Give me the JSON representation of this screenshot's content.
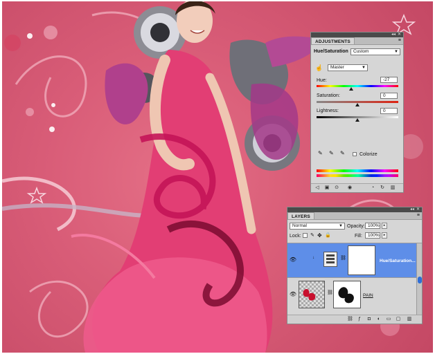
{
  "adjustments_panel": {
    "tab_label": "ADJUSTMENTS",
    "title": "Hue/Saturation",
    "preset_value": "Custom",
    "channel_value": "Master",
    "hue_label": "Hue:",
    "hue_value": "-27",
    "hue_level": 0.425,
    "saturation_label": "Saturation:",
    "saturation_value": "0",
    "saturation_level": 0.5,
    "lightness_label": "Lightness:",
    "lightness_value": "0",
    "lightness_level": 0.5,
    "colorize_label": "Colorize"
  },
  "layers_panel": {
    "tab_label": "LAYERS",
    "blend_mode": "Normal",
    "opacity_label": "Opacity:",
    "opacity_value": "100%",
    "lock_label": "Lock:",
    "fill_label": "Fill:",
    "fill_value": "100%",
    "layers": [
      {
        "name": "Hue/Saturation...",
        "selected": true
      },
      {
        "name": "PAIN",
        "selected": false
      }
    ]
  },
  "colors": {
    "selection_blue": "#5e8ee8",
    "panel_gray": "#d6d6d6",
    "canvas_pink": "#d95d78"
  }
}
